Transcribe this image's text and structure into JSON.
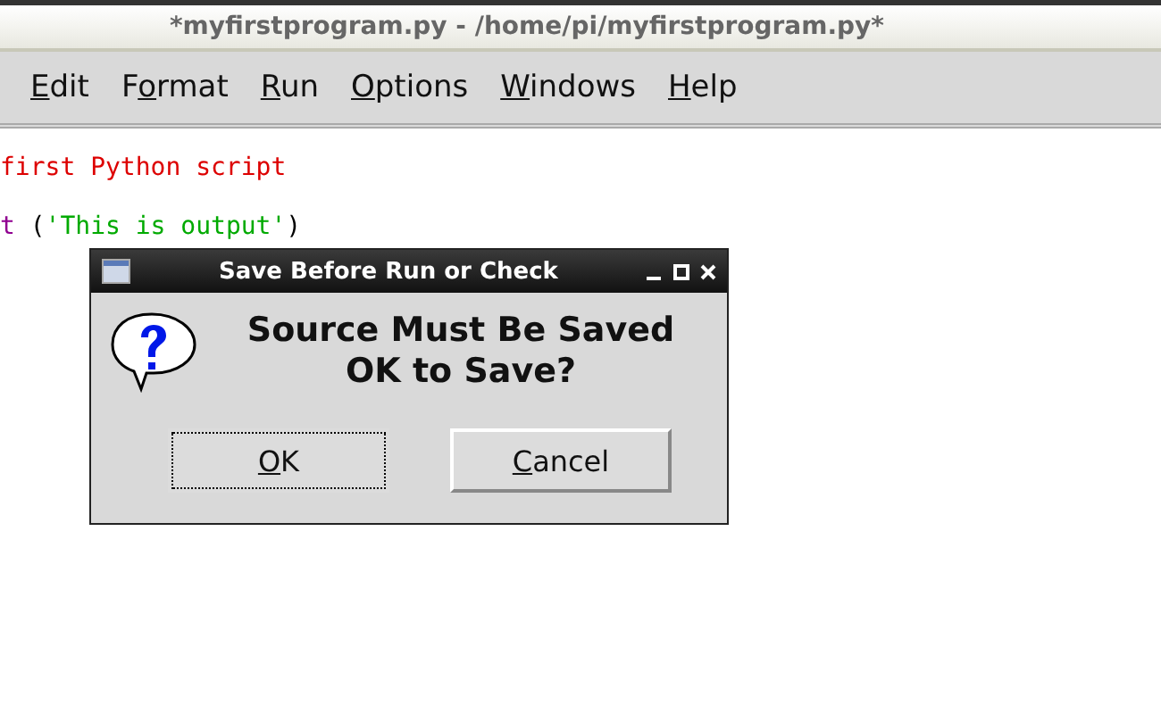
{
  "window": {
    "title": "*myfirstprogram.py - /home/pi/myfirstprogram.py*"
  },
  "menu": [
    {
      "key": "E",
      "after": "dit"
    },
    {
      "before": "F",
      "key": "o",
      "after": "rmat"
    },
    {
      "key": "R",
      "after": "un"
    },
    {
      "key": "O",
      "after": "ptions"
    },
    {
      "key": "W",
      "after": "indows"
    },
    {
      "key": "H",
      "after": "elp"
    }
  ],
  "code": [
    [
      {
        "kind": "comment",
        "text": "first Python script"
      }
    ],
    [
      {
        "kind": "builtin",
        "text": "t"
      },
      {
        "kind": "plain",
        "text": " ("
      },
      {
        "kind": "string",
        "text": "'This is output'"
      },
      {
        "kind": "plain",
        "text": ")"
      }
    ]
  ],
  "dialog": {
    "title": "Save Before Run or Check",
    "message": [
      "Source Must Be Saved",
      "OK to Save?"
    ],
    "buttons": [
      {
        "key": "O",
        "after": "K",
        "focused": true
      },
      {
        "key": "C",
        "after": "ancel",
        "focused": false
      }
    ]
  }
}
